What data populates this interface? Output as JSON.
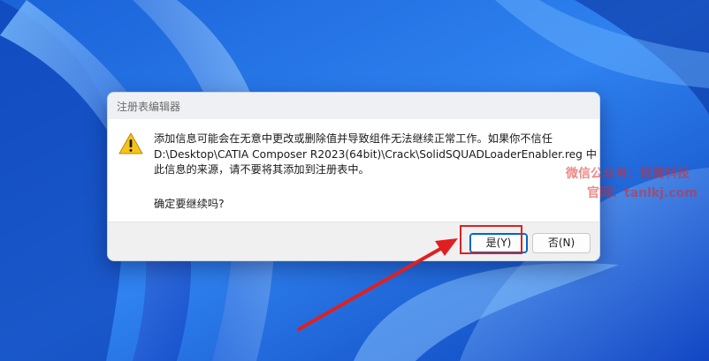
{
  "dialog": {
    "title": "注册表编辑器",
    "message_lines": [
      "添加信息可能会在无意中更改或删除值并导致组件无法继续正常工作。如果你不信任",
      "D:\\Desktop\\CATIA Composer R2023(64bit)\\Crack\\SolidSQUADLoaderEnabler.reg 中",
      "此信息的来源，请不要将其添加到注册表中。"
    ],
    "question": "确定要继续吗?",
    "buttons": {
      "yes_label": "是(Y)",
      "no_label": "否(N)"
    },
    "icon": "warning-icon"
  },
  "watermark": {
    "line1": "微信公众号：探篱科技",
    "line2": "官网：tanlkj.com"
  },
  "colors": {
    "accent": "#0067c0",
    "highlight": "#e02020",
    "warning": "#f6c21b"
  }
}
